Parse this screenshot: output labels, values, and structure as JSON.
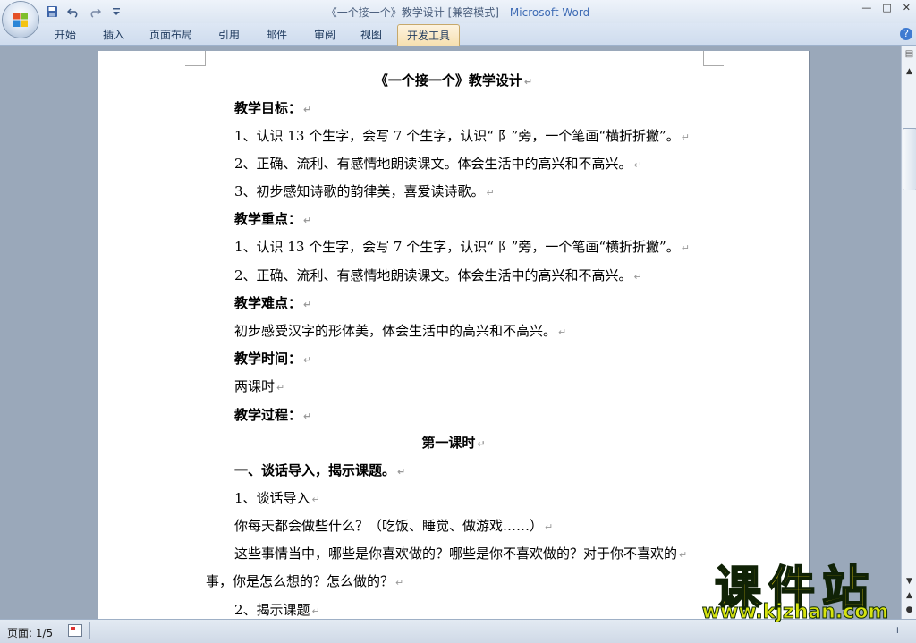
{
  "window": {
    "title_prefix": "《一个接一个》教学设计 [兼容模式] - ",
    "title_app": "Microsoft Word",
    "minimize": "—",
    "restore": "□",
    "close": "✕"
  },
  "qat": {
    "save_icon": "save-icon",
    "undo_icon": "undo-icon",
    "redo_icon": "redo-icon",
    "customize_icon": "customize-icon"
  },
  "ribbon": {
    "tabs": [
      "开始",
      "插入",
      "页面布局",
      "引用",
      "邮件",
      "审阅",
      "视图",
      "开发工具"
    ],
    "active_tab": "开发工具",
    "help": "?"
  },
  "document": {
    "title": "《一个接一个》教学设计",
    "lines": [
      {
        "text": "教学目标：",
        "bold": true
      },
      {
        "text": "1、认识 13 个生字，会写 7 个生字，认识“ ⻖”旁，一个笔画“横折折撇”。",
        "bold": false
      },
      {
        "text": "2、正确、流利、有感情地朗读课文。体会生活中的高兴和不高兴。",
        "bold": false
      },
      {
        "text": "3、初步感知诗歌的韵律美，喜爱读诗歌。",
        "bold": false
      },
      {
        "text": "教学重点：",
        "bold": true
      },
      {
        "text": "1、认识 13 个生字，会写 7 个生字，认识“ ⻖”旁，一个笔画“横折折撇”。",
        "bold": false
      },
      {
        "text": "2、正确、流利、有感情地朗读课文。体会生活中的高兴和不高兴。",
        "bold": false
      },
      {
        "text": "教学难点：",
        "bold": true
      },
      {
        "text": "初步感受汉字的形体美，体会生活中的高兴和不高兴。",
        "bold": false
      },
      {
        "text": "教学时间：",
        "bold": true
      },
      {
        "text": "两课时",
        "bold": false
      },
      {
        "text": "教学过程：",
        "bold": true
      },
      {
        "text": "第一课时",
        "bold": true
      },
      {
        "text": "一、谈话导入，揭示课题。",
        "bold": true
      },
      {
        "text": "1、谈话导入",
        "bold": false
      },
      {
        "text": "你每天都会做些什么？（吃饭、睡觉、做游戏……）",
        "bold": false
      },
      {
        "text": "这些事情当中，哪些是你喜欢做的？哪些是你不喜欢做的？对于你不喜欢的",
        "bold": false
      },
      {
        "text": "事，你是怎么想的？怎么做的？",
        "bold": false
      },
      {
        "text": "2、揭示课题",
        "bold": false
      }
    ],
    "para_mark": "↵"
  },
  "statusbar": {
    "page": "页面: 1/5"
  },
  "watermark": {
    "logo": "课件站",
    "url": "www.kjzhan.com"
  },
  "colors": {
    "ribbon": "#cfdcee",
    "workspace": "#9aa8ba",
    "title_app": "#3f6cb5",
    "watermark_yellow": "#f4d70f"
  }
}
